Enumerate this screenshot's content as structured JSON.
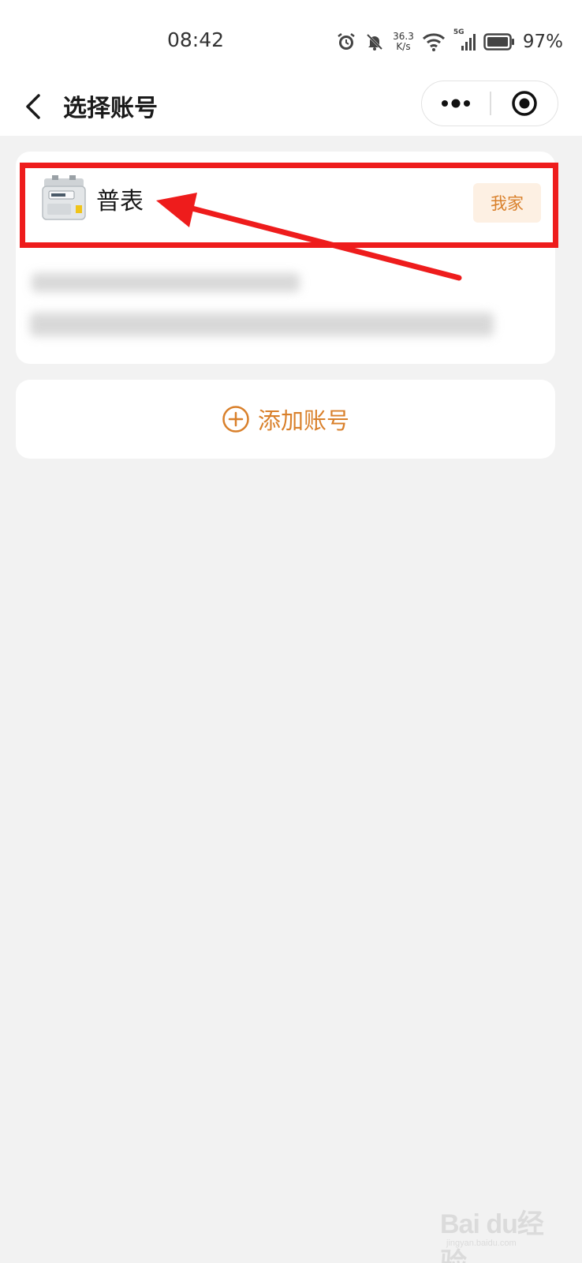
{
  "status_bar": {
    "time": "08:42",
    "net_speed_value": "36.3",
    "net_speed_unit": "K/s",
    "network_type": "5G",
    "battery": "97%"
  },
  "nav": {
    "title": "选择账号"
  },
  "account": {
    "name": "普表",
    "tag": "我家"
  },
  "add_account": {
    "label": "添加账号"
  },
  "colors": {
    "accent": "#d9802b",
    "tag_bg": "#fdf0e3",
    "annotation": "#ee1c1c",
    "page_bg": "#f2f2f2"
  },
  "watermark": {
    "brand": "Bai du经验",
    "url": "jingyan.baidu.com"
  }
}
